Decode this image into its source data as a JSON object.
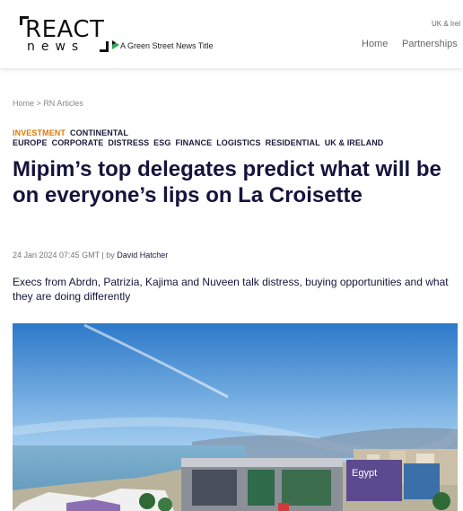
{
  "header": {
    "logo_top": "REACT",
    "logo_bottom": "news",
    "tagline": "A Green Street News Title",
    "region": "UK & Irel",
    "nav": [
      "Home",
      "Partnerships"
    ]
  },
  "breadcrumb": {
    "home": "Home",
    "separator": ">",
    "section": "RN Articles"
  },
  "tags": {
    "row1": [
      {
        "label": "INVESTMENT",
        "highlight": true
      },
      {
        "label": "CONTINENTAL",
        "highlight": false
      }
    ],
    "row2": [
      "EUROPE",
      "CORPORATE",
      "DISTRESS",
      "ESG",
      "FINANCE",
      "LOGISTICS",
      "RESIDENTIAL",
      "UK & IRELAND"
    ]
  },
  "article": {
    "headline": "Mipim’s top delegates predict what will be on everyone’s lips on La Croisette",
    "timestamp": "24 Jan 2024 07:45 GMT",
    "by_prefix": "| by",
    "author": "David Hatcher",
    "standfirst": "Execs from Abrdn, Patrizia, Kajima and Nuveen talk distress, buying opportunities and what they are doing differently",
    "image_sign": "Egypt"
  },
  "colors": {
    "accent": "#e07a00",
    "headline": "#14143c",
    "green_street": "#2fa84f"
  }
}
